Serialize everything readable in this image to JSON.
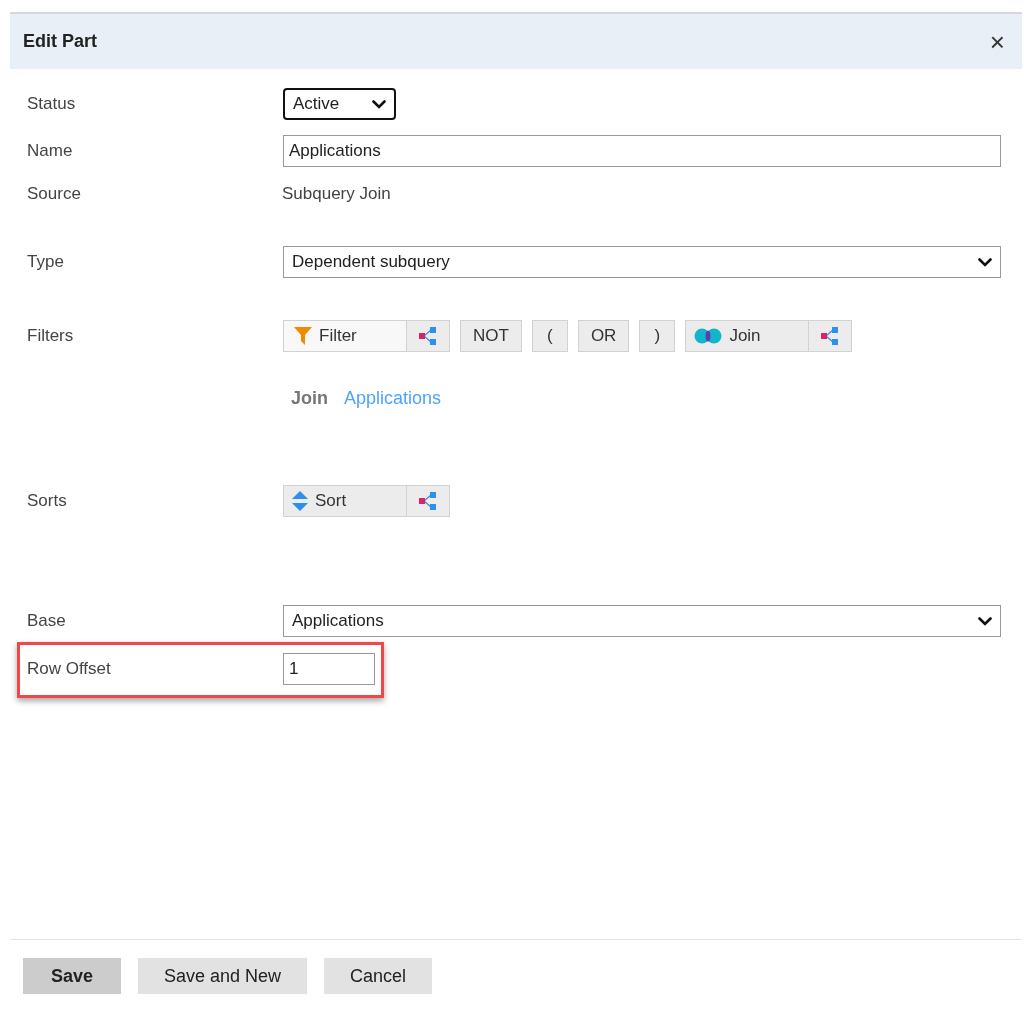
{
  "dialog": {
    "title": "Edit Part",
    "close": "×"
  },
  "rows": [
    {
      "kind": "select",
      "label": "Status",
      "value": "Active",
      "focused": true
    },
    {
      "kind": "input",
      "label": "Name",
      "value": "Applications"
    },
    {
      "kind": "text",
      "label": "Source",
      "value": "Subquery Join"
    },
    {
      "kind": "select",
      "label": "Type",
      "value": "Dependent subquery",
      "focused": false
    },
    {
      "kind": "toolbar",
      "label": "Filters",
      "buttons": [
        {
          "kind": "filter",
          "label": "Filter",
          "split": true
        },
        {
          "kind": "plain",
          "label": "NOT",
          "split": false
        },
        {
          "kind": "plain",
          "label": "(",
          "split": false
        },
        {
          "kind": "plain",
          "label": "OR",
          "split": false
        },
        {
          "kind": "plain",
          "label": ")",
          "split": false
        },
        {
          "kind": "join",
          "label": "Join",
          "split": true
        }
      ],
      "clauses": [
        {
          "label": "Join",
          "link": "Applications"
        }
      ]
    },
    {
      "kind": "toolbar",
      "label": "Sorts",
      "buttons": [
        {
          "kind": "sort",
          "label": "Sort",
          "split": true
        }
      ]
    },
    {
      "kind": "select",
      "label": "Base",
      "value": "Applications",
      "focused": false
    },
    {
      "kind": "input",
      "label": "Row Offset",
      "value": "1",
      "highlighted": true
    }
  ],
  "footer": [
    {
      "label": "Save",
      "primary": true
    },
    {
      "label": "Save and New",
      "primary": false
    },
    {
      "label": "Cancel",
      "primary": false
    }
  ]
}
